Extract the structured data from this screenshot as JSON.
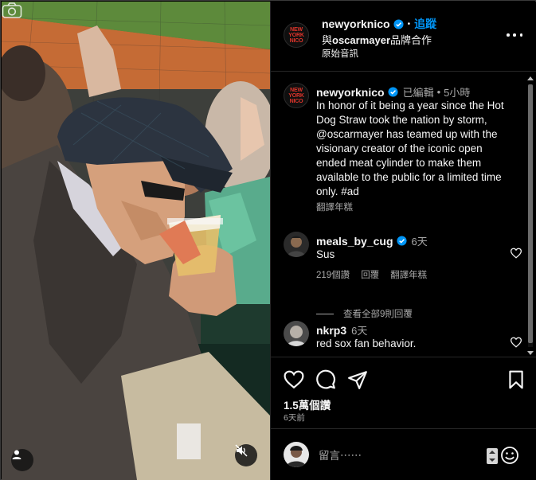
{
  "post": {
    "username": "newyorknico",
    "follow_label": "追蹤",
    "partner_text_prefix": "與",
    "partner_account": "oscarmayer",
    "partner_text_suffix": "品牌合作",
    "audio_label": "原始音訊",
    "brand_logo_text": "NEW\nYORK\nNICO"
  },
  "caption": {
    "username": "newyorknico",
    "edited_label": "已編輯",
    "time": "5小時",
    "text": "In honor of it being a year since the Hot Dog Straw took the nation by storm, @oscarmayer has teamed up with the visionary creator of the iconic open ended meat cylinder to make them available to the public for a limited time only. #ad",
    "translate_label": "翻譯年糕"
  },
  "comments": [
    {
      "username": "meals_by_cug",
      "verified": true,
      "time": "6天",
      "text": "Sus",
      "likes_label": "219個讚",
      "reply_label": "回覆",
      "translate_label": "翻譯年糕",
      "view_replies_label": "查看全部9則回覆"
    },
    {
      "username": "nkrp3",
      "verified": false,
      "time": "6天",
      "text": "red sox fan behavior."
    }
  ],
  "footer": {
    "likes_count": "1.5萬個讚",
    "time_ago": "6天前",
    "comment_placeholder": "留言⋯⋯"
  },
  "icons": {
    "header": "more-options-icon",
    "actions": [
      "heart-icon",
      "comment-icon",
      "share-icon",
      "save-icon"
    ],
    "photo": [
      "camera-icon",
      "user-tag-icon",
      "mute-icon"
    ]
  },
  "colors": {
    "background": "#000000",
    "text": "#f5f5f5",
    "secondary_text": "#a8a8a8",
    "link_blue": "#0095f6",
    "brand_red": "#e0352b"
  }
}
